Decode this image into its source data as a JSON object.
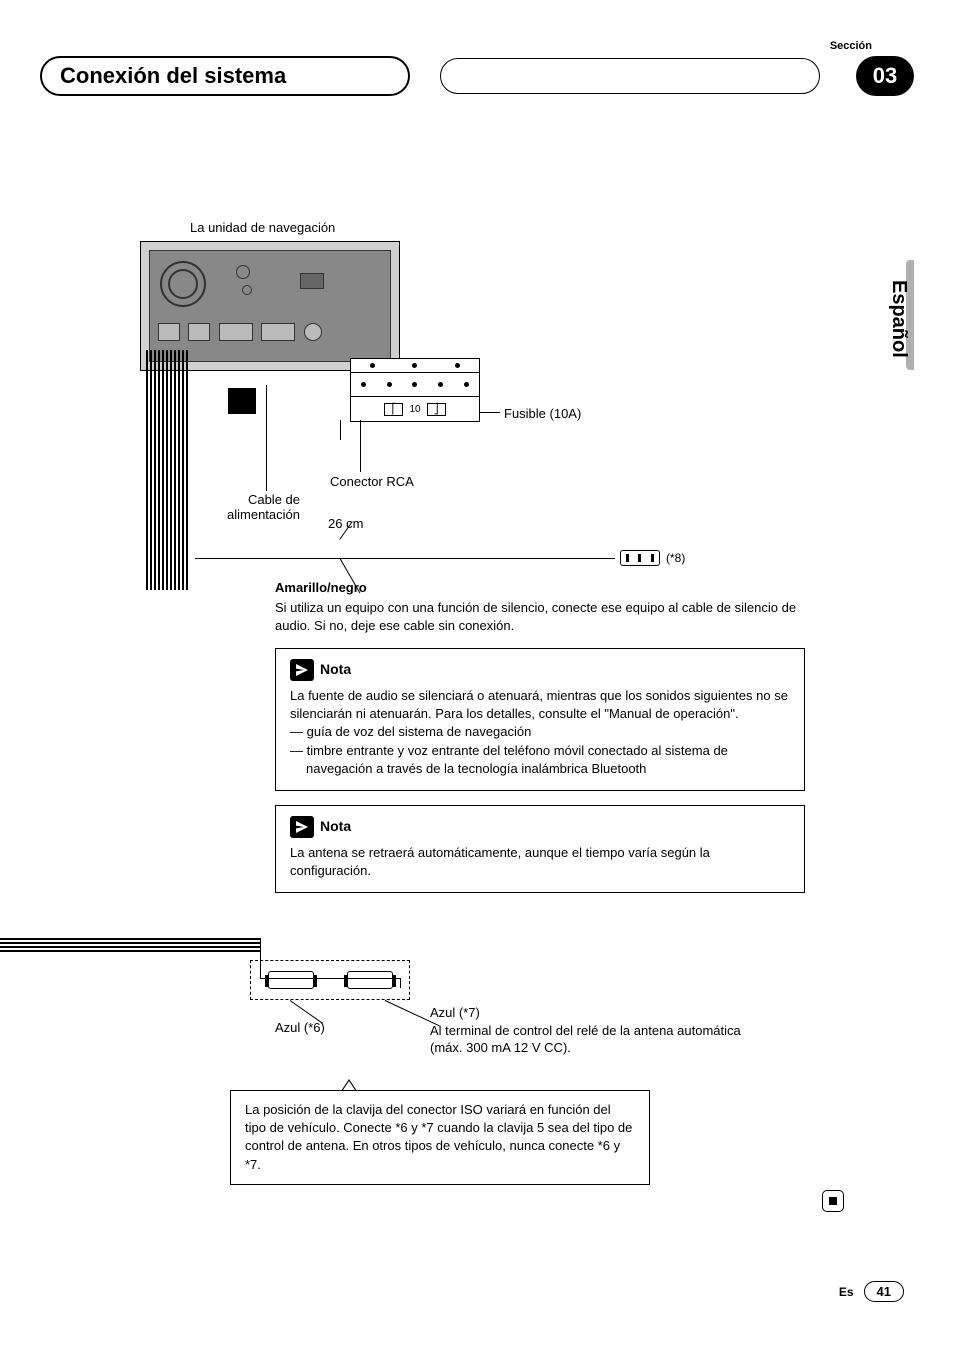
{
  "header": {
    "section_label": "Sección",
    "title": "Conexión del sistema",
    "section_number": "03"
  },
  "sidebar": {
    "language_vertical": "Español"
  },
  "diagram": {
    "nav_unit_label": "La unidad de navegación",
    "fuse_label": "Fusible (10A)",
    "fuse_value": "10",
    "rca_label": "Conector RCA",
    "power_cable_1": "Cable de",
    "power_cable_2": "alimentación",
    "length_label": "26 cm",
    "ref8": "(*8)"
  },
  "amarillo": {
    "heading": "Amarillo/negro",
    "text": "Si utiliza un equipo con una función de silencio, conecte ese equipo al cable de silencio de audio. Si no, deje ese cable sin conexión."
  },
  "note1": {
    "title": "Nota",
    "p1": "La fuente de audio se silenciará o atenuará, mientras que los sonidos siguientes no se silenciarán ni atenuarán. Para los detalles, consulte el \"Manual de operación\".",
    "li1": "— guía de voz del sistema de navegación",
    "li2": "— timbre entrante y voz entrante del teléfono móvil conectado al sistema de navegación a través de la tecnología inalámbrica Bluetooth"
  },
  "note2": {
    "title": "Nota",
    "p1": "La antena se retraerá automáticamente, aunque el tiempo varía según la configuración."
  },
  "blue": {
    "azul6": "Azul (*6)",
    "azul7": "Azul (*7)",
    "azul7_desc": "Al terminal de control del relé de la antena automática (máx. 300 mA 12 V CC)."
  },
  "iso_box": {
    "text": "La posición de la clavija del conector ISO variará en función del tipo de vehículo. Conecte *6 y *7 cuando la clavija 5 sea del tipo de control de antena. En otros tipos de vehículo, nunca conecte *6 y *7."
  },
  "footer": {
    "lang": "Es",
    "page": "41"
  }
}
